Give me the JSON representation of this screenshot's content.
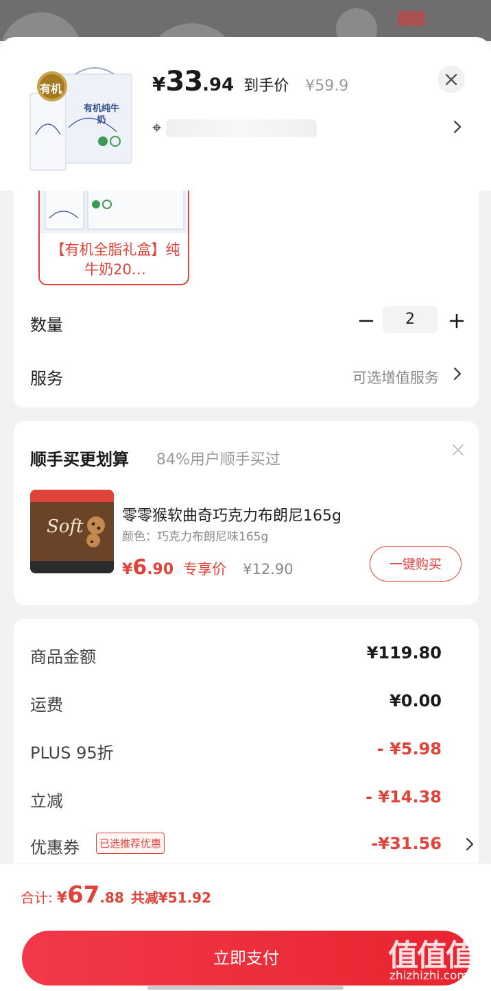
{
  "product": {
    "price_currency": "¥",
    "price_int": "33",
    "price_dec": ".94",
    "price_tag": "到手价",
    "orig_price": "¥59.9",
    "thumb_badge": "有机",
    "thumb_title": "有机纯牛奶"
  },
  "sku": {
    "selected_label": "【有机全脂礼盒】纯牛奶20…"
  },
  "quantity": {
    "label": "数量",
    "value": "2"
  },
  "service": {
    "label": "服务",
    "value": "可选增值服务"
  },
  "upsell": {
    "title": "顺手买更划算",
    "subtitle": "84%用户顺手买过",
    "item_name": "零零猴软曲奇巧克力布朗尼165g",
    "item_spec": "颜色：巧克力布朗尼味165g",
    "price_currency": "¥",
    "price_int": "6",
    "price_dec": ".90",
    "price_tag": "专享价",
    "orig_price": "¥12.90",
    "buy_label": "一键购买"
  },
  "summary": {
    "rows": [
      {
        "label": "商品金额",
        "value": "¥119.80"
      },
      {
        "label": "运费",
        "value": "¥0.00"
      },
      {
        "label": "PLUS 95折",
        "value": "- ¥5.98"
      },
      {
        "label": "立减",
        "value": "- ¥14.38"
      },
      {
        "label": "优惠券",
        "value": "-¥31.56",
        "tag": "已选推荐优惠"
      }
    ]
  },
  "footer": {
    "total_label": "合计:",
    "total_currency": "¥",
    "total_int": "67",
    "total_dec": ".88",
    "saved": "共减¥51.92",
    "pay_label": "立即支付"
  },
  "watermark": {
    "text": "值值值",
    "url": "zhizhizhi.com"
  },
  "colors": {
    "accent": "#e0433a",
    "pay_button": "#ec2b36"
  }
}
